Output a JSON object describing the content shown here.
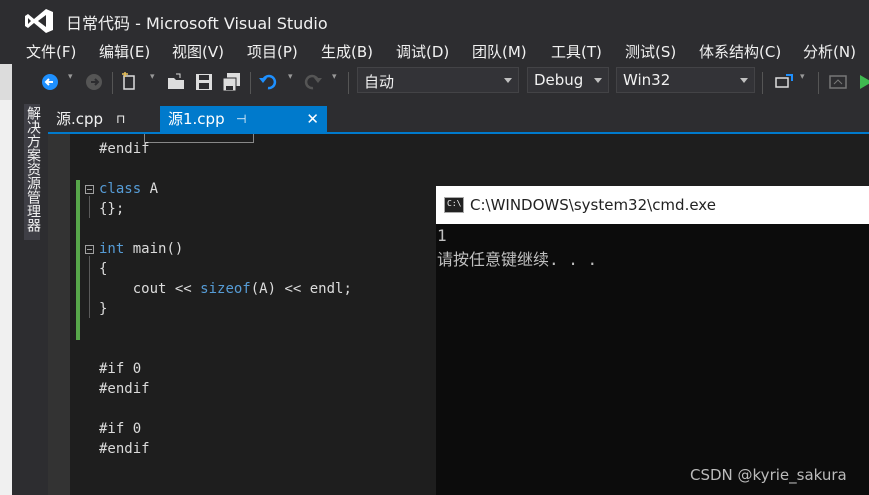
{
  "window": {
    "title": "日常代码 - Microsoft Visual Studio"
  },
  "menu": [
    "文件(F)",
    "编辑(E)",
    "视图(V)",
    "项目(P)",
    "生成(B)",
    "调试(D)",
    "团队(M)",
    "工具(T)",
    "测试(S)",
    "体系结构(C)",
    "分析(N)"
  ],
  "toolbar": {
    "solution_config": "自动",
    "config": "Debug",
    "platform": "Win32"
  },
  "side_panel": {
    "label": "解决方案资源管理器"
  },
  "tabs": {
    "inactive": {
      "label": "源.cpp",
      "pin": "⊓"
    },
    "active": {
      "label": "源1.cpp",
      "pin": "⊣",
      "close": "✕"
    }
  },
  "code": {
    "line0": "#endif",
    "line1_kw": "class",
    "line1_rest": " A",
    "line2": "{};",
    "line3_kw": "int",
    "line3_rest": " main()",
    "line4": "{",
    "line5_a": "    cout << ",
    "line5_kw": "sizeof",
    "line5_b": "(A) << endl;",
    "line6": "}",
    "line7": "#if 0",
    "line8": "#endif",
    "line9": "#if 0",
    "line10": "#endif"
  },
  "console": {
    "title": "C:\\WINDOWS\\system32\\cmd.exe",
    "icon_text": "C:\\",
    "out1": "1",
    "out2": "请按任意键继续. . ."
  },
  "watermark": "CSDN @kyrie_sakura",
  "colors": {
    "accent": "#007acc",
    "keyword": "#569cd6",
    "change_bar": "#57a64a"
  }
}
